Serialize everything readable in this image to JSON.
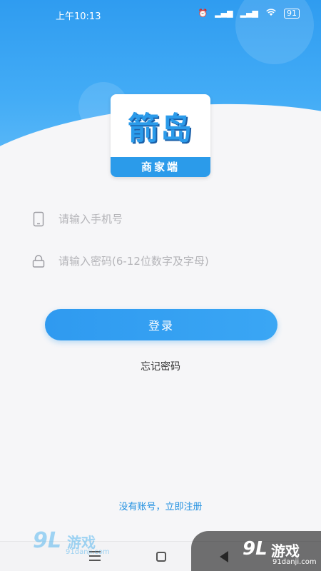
{
  "status_bar": {
    "time": "上午10:13",
    "battery": "91"
  },
  "logo": {
    "title": "箭岛",
    "subtitle": "商家端"
  },
  "form": {
    "phone_placeholder": "请输入手机号",
    "password_placeholder": "请输入密码(6-12位数字及字母)",
    "login_label": "登录",
    "forgot_label": "忘记密码"
  },
  "footer": {
    "register_label": "没有账号，立即注册"
  },
  "watermark": {
    "brand_mark": "9L",
    "brand_name": "游戏",
    "site": "91danji.com"
  },
  "colors": {
    "primary": "#2f9af0",
    "link": "#1f8fe0",
    "background": "#f6f6f8"
  }
}
